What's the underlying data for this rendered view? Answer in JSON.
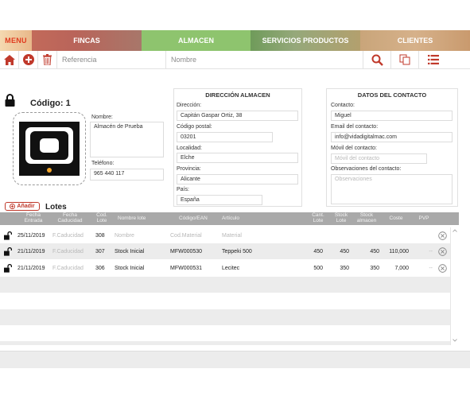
{
  "nav": {
    "menu_label": "MENU",
    "tabs": [
      {
        "label": "FINCAS"
      },
      {
        "label": "ALMACEN"
      },
      {
        "label": "SERVICIOS PRODUCTOS"
      },
      {
        "label": "CLIENTES"
      }
    ],
    "active_tab": "ALMACEN",
    "accent_color": "#8ec46e"
  },
  "toolbar": {
    "referencia_placeholder": "Referencia",
    "nombre_placeholder": "Nombre",
    "icons": [
      "home-icon",
      "add-icon",
      "trash-icon",
      "search-icon",
      "copy-icon",
      "list-icon"
    ]
  },
  "record": {
    "codigo_label": "Código: 1",
    "nombre_label": "Nombre:",
    "nombre_value": "Almacén de Prueba",
    "telefono_label": "Teléfono:",
    "telefono_value": "965 440 117"
  },
  "direccion": {
    "title": "DIRECCIÓN ALMACEN",
    "direccion_label": "Dirección:",
    "direccion_value": "Capitán Gaspar Ortiz, 38",
    "cp_label": "Código postal:",
    "cp_value": "03201",
    "localidad_label": "Localidad:",
    "localidad_value": "Elche",
    "provincia_label": "Provincia:",
    "provincia_value": "Alicante",
    "pais_label": "País:",
    "pais_value": "España"
  },
  "contacto": {
    "title": "DATOS DEL CONTACTO",
    "contacto_label": "Contacto:",
    "contacto_value": "Miguel",
    "email_label": "Email del contacto:",
    "email_value": "info@vidadigitalmac.com",
    "movil_label": "Móvil del contacto:",
    "movil_placeholder": "Móvil del contacto",
    "obs_label": "Observaciones del contacto:",
    "obs_placeholder": "Observaciones"
  },
  "lotes": {
    "add_label": "Añadir",
    "title": "Lotes",
    "headers": {
      "fecha_entrada": "Fecha Entrada",
      "fecha_caducidad": "Fecha Caducidad",
      "cod_lote": "Cod. Lote",
      "nombre_lote": "Nombre lote",
      "codigo_ean": "Código/EAN",
      "articulo": "Artículo",
      "cant_lote": "Cant. Lote",
      "stock_lote": "Stock Lote",
      "stock_almacen": "Stock almacen",
      "coste": "Coste",
      "pvp": "PVP"
    },
    "rows": [
      {
        "fecha_entrada": "25/11/2019",
        "fecha_caducidad": "F.Caducidad",
        "cod_lote": "308",
        "nombre_lote": "Nombre",
        "codigo_ean": "Cod.Material",
        "articulo": "Material",
        "cant_lote": "",
        "stock_lote": "",
        "stock_almacen": "",
        "coste": "",
        "pvp": ""
      },
      {
        "fecha_entrada": "21/11/2019",
        "fecha_caducidad": "F.Caducidad",
        "cod_lote": "307",
        "nombre_lote": "Stock Inicial",
        "codigo_ean": "MFW000530",
        "articulo": "Teppeki 500",
        "cant_lote": "450",
        "stock_lote": "450",
        "stock_almacen": "450",
        "coste": "110,000",
        "pvp": "--"
      },
      {
        "fecha_entrada": "21/11/2019",
        "fecha_caducidad": "F.Caducidad",
        "cod_lote": "306",
        "nombre_lote": "Stock Inicial",
        "codigo_ean": "MFW000531",
        "articulo": "Lecitec",
        "cant_lote": "500",
        "stock_lote": "350",
        "stock_almacen": "350",
        "coste": "7,000",
        "pvp": "--"
      }
    ]
  }
}
